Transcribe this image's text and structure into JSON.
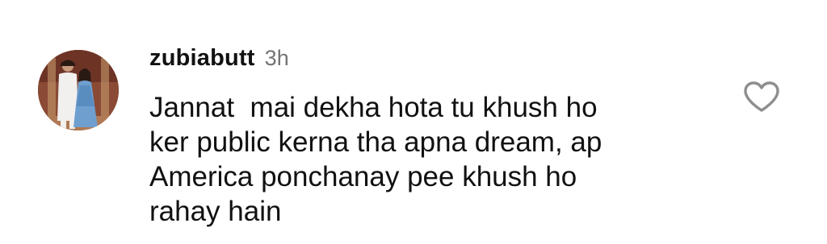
{
  "comment": {
    "username": "zubiabutt",
    "time": "3h",
    "text": "Jannat  mai dekha hota tu khush ho\nker public kerna tha apna dream, ap\nAmerica ponchanay pee khush ho\nrahay hain",
    "icons": {
      "avatar": "profile-photo",
      "like": "heart-outline-icon"
    },
    "colors": {
      "username": "#111111",
      "time": "#737373",
      "text": "#111111",
      "icon": "#8e8e8e"
    }
  }
}
